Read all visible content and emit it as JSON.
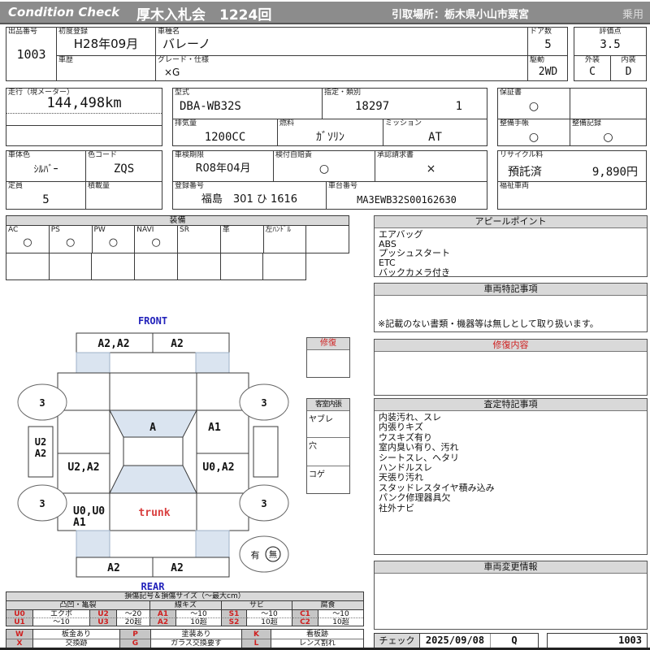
{
  "header": {
    "logo": "Condition  Check",
    "auction": "厚木入札会　1224回",
    "pickup": "引取場所：栃木県小山市粟宮",
    "category": "乗用"
  },
  "info": {
    "lot_label": "出品番号",
    "lot": "1003",
    "first_reg_label": "初度登録",
    "first_reg": "H28年09月",
    "model_label": "車種名",
    "model": "バレーノ",
    "history_label": "車歴",
    "history": "",
    "grade_label": "グレード・仕様",
    "grade": "×G",
    "doors_label": "ドア数",
    "doors": "5",
    "drive_label": "駆動",
    "drive": "2WD",
    "score_label": "評価点",
    "score": "3.5",
    "exterior_label": "外装",
    "exterior": "C",
    "interior_label": "内装",
    "interior": "D",
    "mileage_label": "走行（現メーター）",
    "mileage": "144,498km",
    "model_code_label": "型式",
    "model_code": "DBA-WB32S",
    "class_label": "指定・類別",
    "class_no": "18297",
    "class_sub": "1",
    "warranty_label": "保証書",
    "warranty": "○",
    "displacement_label": "排気量",
    "displacement": "1200CC",
    "fuel_label": "燃料",
    "fuel": "ｶﾞｿﾘﾝ",
    "mission_label": "ミッション",
    "mission": "AT",
    "maintenance_book_label": "整備手帳",
    "maintenance_book": "○",
    "maintenance_record_label": "整備記録",
    "maintenance_record": "○",
    "body_color_label": "車体色",
    "body_color": "ｼﾙﾊﾞｰ",
    "color_code_label": "色コード",
    "color_code": "ZQS",
    "inspection_label": "車検期限",
    "inspection": "R08年04月",
    "insurance_label": "検付自賠責",
    "insurance": "○",
    "approval_label": "承認請求書",
    "approval": "×",
    "recycle_label": "リサイクル料",
    "recycle_status": "預託済",
    "recycle_fee": "9,890円",
    "capacity_label": "定員",
    "capacity": "5",
    "load_label": "積載量",
    "load": "",
    "reg_no_label": "登録番号",
    "reg_no": "福島　301 ひ 1616",
    "vin_label": "車台番号",
    "vin": "MA3EWB32S00162630",
    "welfare_label": "福祉車両",
    "welfare": ""
  },
  "equipment": {
    "title": "装備",
    "items": [
      {
        "label": "AC",
        "value": "○"
      },
      {
        "label": "PS",
        "value": "○"
      },
      {
        "label": "PW",
        "value": "○"
      },
      {
        "label": "NAVI",
        "value": "○"
      },
      {
        "label": "SR",
        "value": ""
      },
      {
        "label": "革",
        "value": ""
      },
      {
        "label": "左ﾊﾝﾄﾞﾙ",
        "value": ""
      },
      {
        "label": "",
        "value": ""
      }
    ]
  },
  "diagram": {
    "front_label": "FRONT",
    "rear_label": "REAR",
    "front_bumper_left": "A2,A2",
    "front_bumper_right": "A2",
    "windshield": "A",
    "cowl_right": "A1",
    "left_side_top": "U2",
    "left_side_bottom": "A2",
    "left_door": "U2,A2",
    "right_door": "U0,A2",
    "rear_left_1": "U0,U0",
    "rear_left_2": "A1",
    "trunk": "trunk",
    "rear_bumper_left": "A2",
    "rear_bumper_right": "A2",
    "wheel_fl": "3",
    "wheel_fr": "3",
    "wheel_rl": "3",
    "wheel_rr": "3",
    "presence_yes": "有",
    "presence_no": "無",
    "repair_box_title": "修復",
    "interior_box_title": "客室内張",
    "interior_items": [
      "ヤブレ",
      "穴",
      "コゲ"
    ]
  },
  "panels": {
    "appeal": {
      "title": "アピールポイント",
      "items": [
        "エアバッグ",
        "ABS",
        "プッシュスタート",
        "ETC",
        "バックカメラ付き"
      ]
    },
    "special": {
      "title": "車両特記事項",
      "note": "※記載のない書類・機器等は無しとして取り扱います。"
    },
    "repair": {
      "title": "修復内容"
    },
    "assessment": {
      "title": "査定特記事項",
      "items": [
        "内装汚れ、スレ",
        "内張りキズ",
        "ウスキズ有り",
        "室内臭い有り、汚れ",
        "シートスレ、ヘタリ",
        "ハンドルスレ",
        "天張り汚れ",
        "スタッドレスタイヤ積み込み",
        "パンク修理器具欠",
        "社外ナビ"
      ]
    },
    "change": {
      "title": "車両変更情報"
    },
    "check": {
      "label": "チェック",
      "date": "2025/09/08",
      "code": "Q",
      "lot": "1003"
    }
  },
  "legend": {
    "title": "損傷記号＆損傷サイズ（～最大cm）",
    "groups": [
      "凸凹・亀裂",
      "線キズ",
      "サビ",
      "腐食"
    ],
    "rows": [
      {
        "cells": [
          {
            "code": "U0",
            "size": "エクボ"
          },
          {
            "code": "U2",
            "size": "～20"
          },
          {
            "code": "A1",
            "size": "～10"
          },
          {
            "code": "S1",
            "size": "～10"
          },
          {
            "code": "C1",
            "size": "～10"
          }
        ]
      },
      {
        "cells": [
          {
            "code": "U1",
            "size": "～10"
          },
          {
            "code": "U3",
            "size": "20超"
          },
          {
            "code": "A2",
            "size": "10超"
          },
          {
            "code": "S2",
            "size": "10超"
          },
          {
            "code": "C2",
            "size": "10超"
          }
        ]
      }
    ],
    "marks": [
      [
        {
          "code": "W",
          "label": "板金あり"
        },
        {
          "code": "P",
          "label": "塗装あり"
        },
        {
          "code": "K",
          "label": "看板跡"
        }
      ],
      [
        {
          "code": "X",
          "label": "交換跡"
        },
        {
          "code": "G",
          "label": "ガラス交換要す"
        },
        {
          "code": "L",
          "label": "レンズ割れ"
        }
      ]
    ],
    "colors": {
      "code_red": "#cf1f1f",
      "header_gray": "#d9d9d9",
      "glass_blue": "#dae4f0"
    }
  }
}
